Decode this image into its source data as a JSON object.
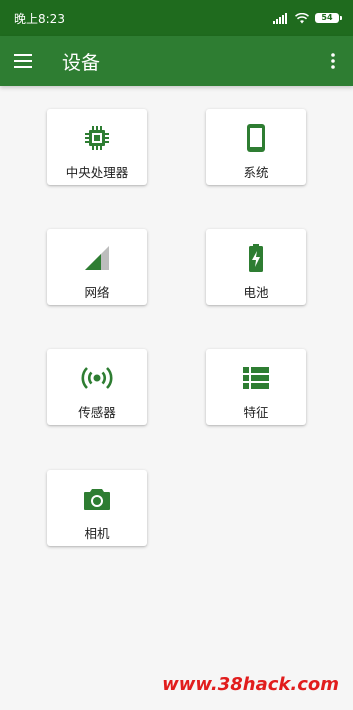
{
  "status_bar": {
    "time": "晚上8:23",
    "battery_level": "54",
    "icons": [
      "signal-icon",
      "wifi-icon",
      "battery-icon"
    ]
  },
  "app_bar": {
    "title": "设备",
    "icons": [
      "menu-icon",
      "more-vert-icon"
    ]
  },
  "cards": [
    {
      "label": "中央处理器",
      "icon": "cpu-icon"
    },
    {
      "label": "系统",
      "icon": "phone-icon"
    },
    {
      "label": "网络",
      "icon": "signal-strength-icon"
    },
    {
      "label": "电池",
      "icon": "battery-charging-icon"
    },
    {
      "label": "传感器",
      "icon": "sensor-icon"
    },
    {
      "label": "特征",
      "icon": "features-list-icon"
    },
    {
      "label": "相机",
      "icon": "camera-icon"
    }
  ],
  "watermark": "www.38hack.com",
  "colors": {
    "status_bar": "#1f6b1e",
    "app_bar": "#2e7d32",
    "icon_green": "#2e7d32",
    "background": "#f6f6f6",
    "watermark": "#e11d1d"
  }
}
